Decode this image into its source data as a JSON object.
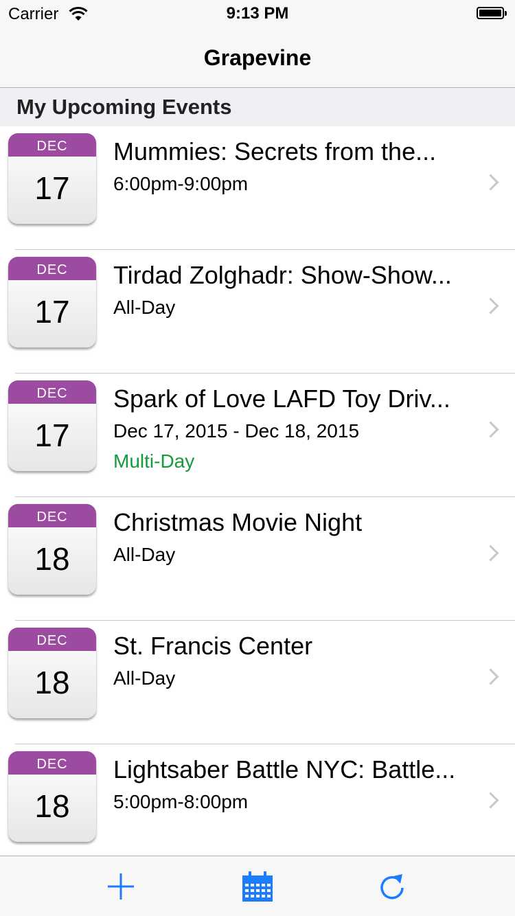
{
  "status_bar": {
    "carrier": "Carrier",
    "time": "9:13 PM",
    "icons": [
      "wifi-icon",
      "battery-icon"
    ]
  },
  "nav": {
    "title": "Grapevine"
  },
  "section": {
    "title": "My Upcoming Events"
  },
  "events": [
    {
      "month": "DEC",
      "day": "17",
      "title": "Mummies: Secrets from the...",
      "time": "6:00pm-9:00pm",
      "badge": ""
    },
    {
      "month": "DEC",
      "day": "17",
      "title": "Tirdad Zolghadr: Show-Show...",
      "time": "All-Day",
      "badge": ""
    },
    {
      "month": "DEC",
      "day": "17",
      "title": "Spark of Love LAFD Toy Driv...",
      "time": "Dec 17, 2015 - Dec 18, 2015",
      "badge": "Multi-Day"
    },
    {
      "month": "DEC",
      "day": "18",
      "title": "Christmas Movie Night",
      "time": "All-Day",
      "badge": ""
    },
    {
      "month": "DEC",
      "day": "18",
      "title": "St. Francis Center",
      "time": "All-Day",
      "badge": ""
    },
    {
      "month": "DEC",
      "day": "18",
      "title": "Lightsaber Battle NYC: Battle...",
      "time": "5:00pm-8:00pm",
      "badge": ""
    }
  ],
  "toolbar": {
    "buttons": [
      "plus-icon",
      "calendar-icon",
      "refresh-icon"
    ]
  },
  "colors": {
    "accent": "#1b7cff",
    "calendar_header": "#9b4ca0",
    "multi_day": "#159a3c",
    "bar_background": "#f7f7f7",
    "section_background": "#efeff4"
  }
}
